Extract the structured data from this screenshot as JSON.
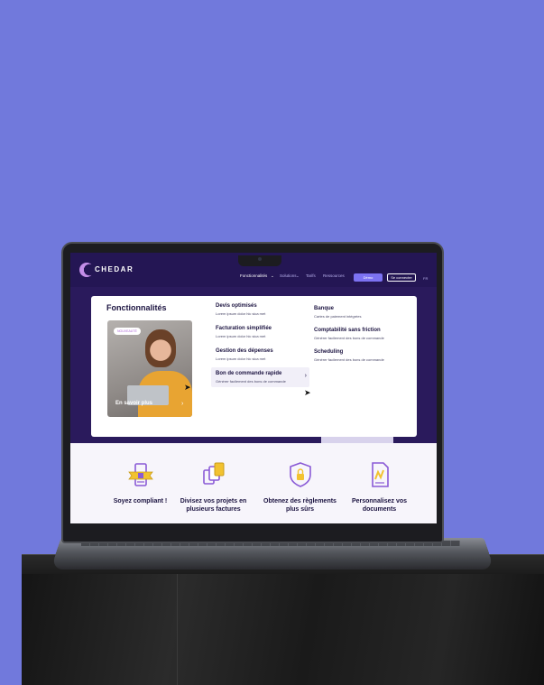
{
  "brand": {
    "logo_letter": "C",
    "logo_text": "HEDAR"
  },
  "nav": {
    "links": [
      "Fonctionnalités",
      "Solutions",
      "Tarifs",
      "Ressources"
    ],
    "active": "Fonctionnalités",
    "demo_label": "Démo",
    "login_label": "Se connecter",
    "lang": "FR"
  },
  "dropdown": {
    "title": "Fonctionnalités",
    "card": {
      "badge": "NOUVEAUTÉ",
      "cta": "En savoir plus",
      "arrow": "›"
    },
    "col1": [
      {
        "title": "Devis optimisés",
        "desc": "Lorem ipsum dolor hic sica met"
      },
      {
        "title": "Facturation simplifiée",
        "desc": "Lorem ipsum dolor hic sica met"
      },
      {
        "title": "Gestion des dépenses",
        "desc": "Lorem ipsum dolor hic sica met"
      },
      {
        "title": "Bon de commande rapide",
        "desc": "Générer facilement des bons de commande"
      }
    ],
    "col2": [
      {
        "title": "Banque",
        "desc": "Cartes de paiement intégrées"
      },
      {
        "title": "Comptabilité sans friction",
        "desc": "Générer facilement des bons de commande"
      },
      {
        "title": "Scheduling",
        "desc": "Générer facilement des bons de commande"
      }
    ]
  },
  "features": [
    {
      "label": "Soyez compliant !",
      "icon": "award-document-icon"
    },
    {
      "label": "Divisez vos projets en plusieurs factures",
      "icon": "split-documents-icon"
    },
    {
      "label": "Obtenez des règlements plus sûrs",
      "icon": "shield-lock-icon"
    },
    {
      "label": "Personnalisez vos documents",
      "icon": "custom-document-icon"
    }
  ],
  "colors": {
    "background": "#7179dc",
    "nav": "#241654",
    "accent": "#7c72f2",
    "icon_purple": "#8a5ad6",
    "icon_yellow": "#f2c230"
  }
}
